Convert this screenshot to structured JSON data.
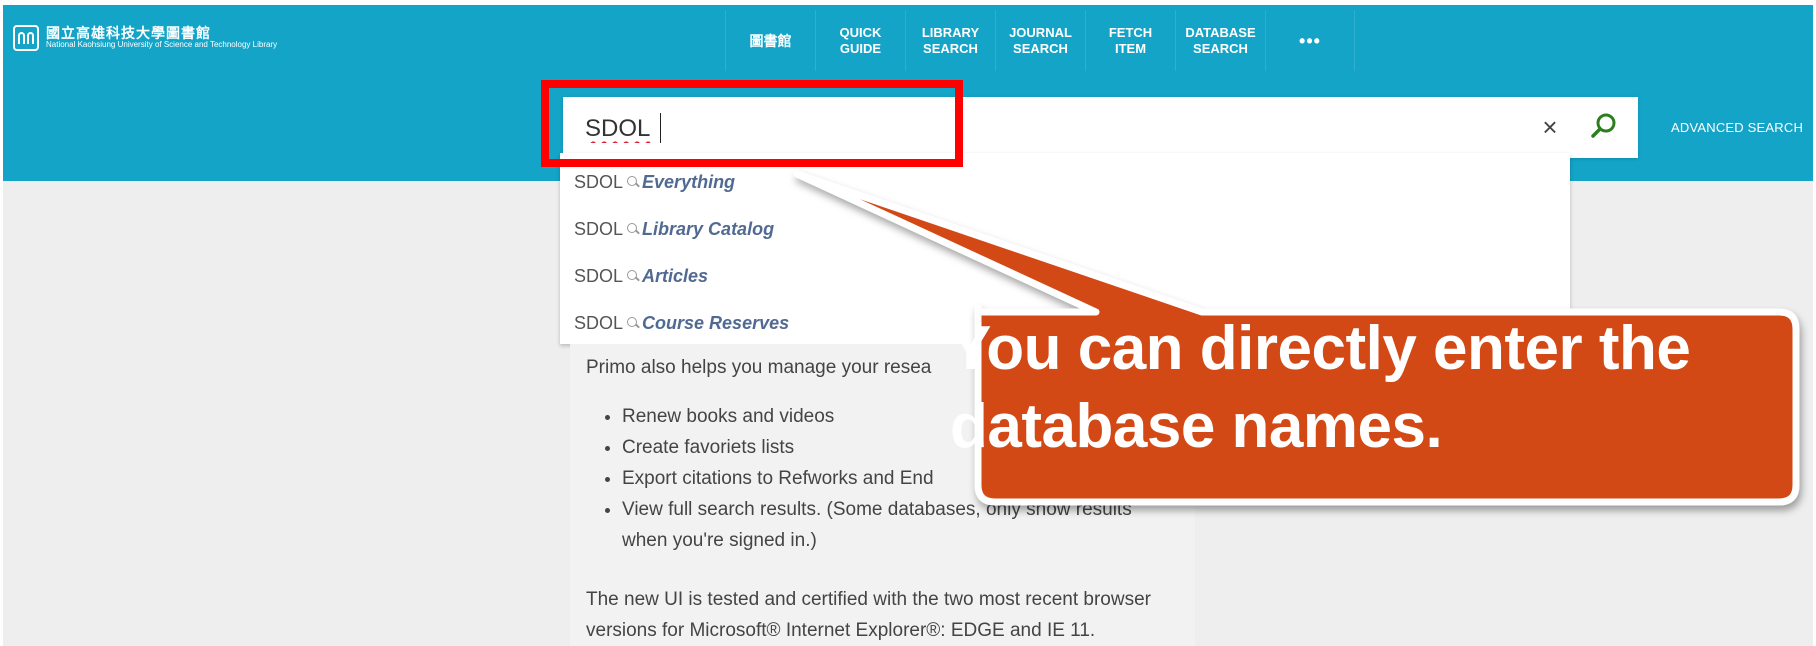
{
  "branding": {
    "logo_zh": "國立高雄科技大學圖書館",
    "logo_en": "National Kaohsiung University of Science and Technology Library"
  },
  "nav": {
    "items": [
      {
        "label": "圖書館"
      },
      {
        "label": "QUICK\nGUIDE"
      },
      {
        "label": "LIBRARY\nSEARCH"
      },
      {
        "label": "JOURNAL\nSEARCH"
      },
      {
        "label": "FETCH\nITEM"
      },
      {
        "label": "DATABASE\nSEARCH"
      },
      {
        "label": "•••"
      }
    ]
  },
  "search": {
    "value": "SDOL",
    "clear_icon": "×",
    "advanced_label": "ADVANCED SEARCH"
  },
  "suggestions": [
    {
      "term": "SDOL",
      "scope": "Everything"
    },
    {
      "term": "SDOL",
      "scope": "Library Catalog"
    },
    {
      "term": "SDOL",
      "scope": "Articles"
    },
    {
      "term": "SDOL",
      "scope": "Course Reserves"
    }
  ],
  "content": {
    "intro": "Primo also helps you manage your resea",
    "items": [
      {
        "text": "Renew books and videos"
      },
      {
        "text": "Create favoriets lists"
      },
      {
        "text": "Export citations to Refworks and End"
      },
      {
        "text": "View full search results. (Some databases, only show results",
        "text2": "when you're signed in.)"
      }
    ],
    "footer_line1": "The new UI is tested and certified with the two most recent browser",
    "footer_line2": "versions for Microsoft® Internet Explorer®: EDGE and IE 11."
  },
  "callout": {
    "line1": "You can directly enter the",
    "line2": "database names."
  },
  "colors": {
    "header": "#13a4c8",
    "highlight": "#ff0000",
    "callout_fill": "#d24a19",
    "search_icon": "#2e7d1f",
    "scope_text": "#516a91"
  }
}
